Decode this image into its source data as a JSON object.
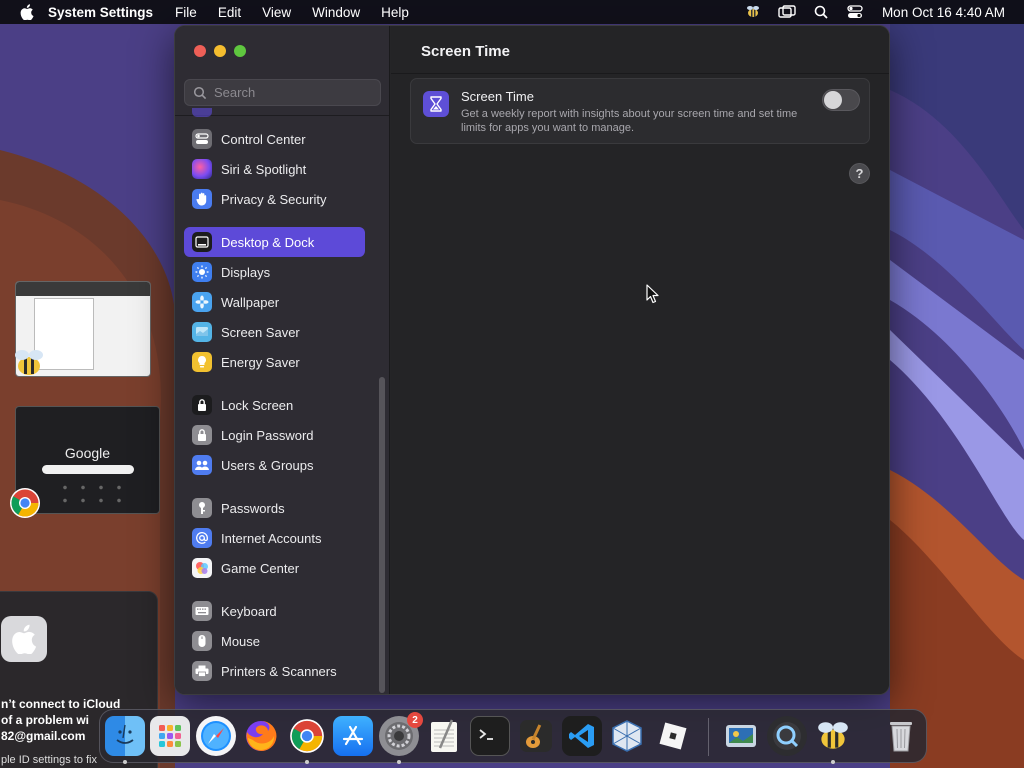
{
  "menubar": {
    "app_name": "System Settings",
    "menus": [
      "File",
      "Edit",
      "View",
      "Window",
      "Help"
    ],
    "clock": "Mon Oct 16  4:40 AM"
  },
  "notification": {
    "line1": "n’t connect to iCloud",
    "line2": "of a problem wi",
    "line3": "82@gmail.com",
    "line4": "ple ID settings to fix"
  },
  "thumbnails": {
    "google_label": "Google"
  },
  "sidebar": {
    "search_placeholder": "Search",
    "items": [
      {
        "label": "Control Center",
        "icon": "control-center-icon",
        "color": "#6e6d73"
      },
      {
        "label": "Siri & Spotlight",
        "icon": "siri-icon",
        "color": "#8a5cf0"
      },
      {
        "label": "Privacy & Security",
        "icon": "hand-icon",
        "color": "#4a7cf0"
      },
      {
        "label": "Desktop & Dock",
        "icon": "dock-icon",
        "color": "#1c1c1e",
        "active": true
      },
      {
        "label": "Displays",
        "icon": "sun-icon",
        "color": "#3f7ff0"
      },
      {
        "label": "Wallpaper",
        "icon": "flower-icon",
        "color": "#4aa3ef"
      },
      {
        "label": "Screen Saver",
        "icon": "screensaver-icon",
        "color": "#54b4e6"
      },
      {
        "label": "Energy Saver",
        "icon": "bulb-icon",
        "color": "#f2c130"
      },
      {
        "label": "Lock Screen",
        "icon": "lock-icon",
        "color": "#1c1c1e"
      },
      {
        "label": "Login Password",
        "icon": "padlock-icon",
        "color": "#8e8d92"
      },
      {
        "label": "Users & Groups",
        "icon": "users-icon",
        "color": "#4f7cf0"
      },
      {
        "label": "Passwords",
        "icon": "key-icon",
        "color": "#8e8d92"
      },
      {
        "label": "Internet Accounts",
        "icon": "at-icon",
        "color": "#4f7cf0"
      },
      {
        "label": "Game Center",
        "icon": "game-center-icon",
        "color": "#ffffff"
      },
      {
        "label": "Keyboard",
        "icon": "keyboard-icon",
        "color": "#8e8d92"
      },
      {
        "label": "Mouse",
        "icon": "mouse-icon",
        "color": "#8e8d92"
      },
      {
        "label": "Printers & Scanners",
        "icon": "printer-icon",
        "color": "#8e8d92"
      }
    ]
  },
  "main": {
    "title": "Screen Time",
    "card": {
      "title": "Screen Time",
      "description": "Get a weekly report with insights about your screen time and set time limits for apps you want to manage.",
      "toggle_on": false
    },
    "help_label": "?"
  },
  "dock": {
    "settings_badge": "2",
    "apps": [
      "finder-icon",
      "launchpad-icon",
      "safari-icon",
      "firefox-icon",
      "chrome-icon",
      "app-store-icon",
      "system-settings-icon",
      "textedit-icon",
      "terminal-icon",
      "garageband-icon",
      "vscode-icon",
      "virtualbox-icon",
      "roblox-icon",
      "preview-icon",
      "quicktime-icon",
      "cyberduck-icon",
      "trash-icon"
    ]
  }
}
